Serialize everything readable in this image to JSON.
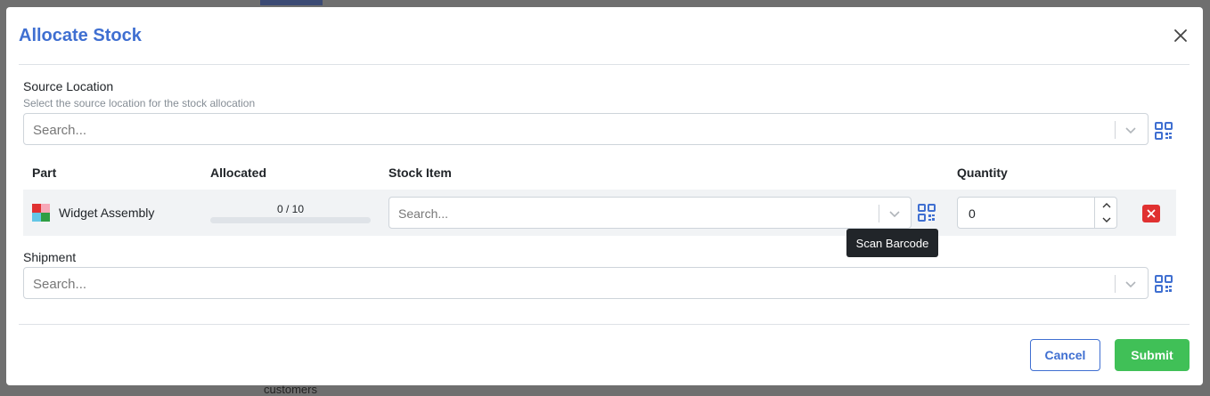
{
  "dialog": {
    "title": "Allocate Stock"
  },
  "source_location": {
    "label": "Source Location",
    "description": "Select the source location for the stock allocation",
    "placeholder": "Search..."
  },
  "table": {
    "headers": [
      "Part",
      "Allocated",
      "Stock Item",
      "Quantity"
    ],
    "rows": [
      {
        "part": "Widget Assembly",
        "allocated_text": "0 / 10",
        "allocated_fraction": 0,
        "stock_item_placeholder": "Search...",
        "quantity": "0"
      }
    ]
  },
  "tooltip": "Scan Barcode",
  "shipment": {
    "label": "Shipment",
    "placeholder": "Search..."
  },
  "buttons": {
    "cancel": "Cancel",
    "submit": "Submit"
  },
  "background": {
    "partial_text": "customers"
  },
  "colors": {
    "accent": "#3f6fd1",
    "submit": "#40c057",
    "delete": "#e03131"
  },
  "icons": [
    "close-icon",
    "chevron-down-icon",
    "qr-code-icon",
    "delete-icon",
    "caret-up-icon",
    "caret-down-icon",
    "part-thumbnail-icon"
  ]
}
